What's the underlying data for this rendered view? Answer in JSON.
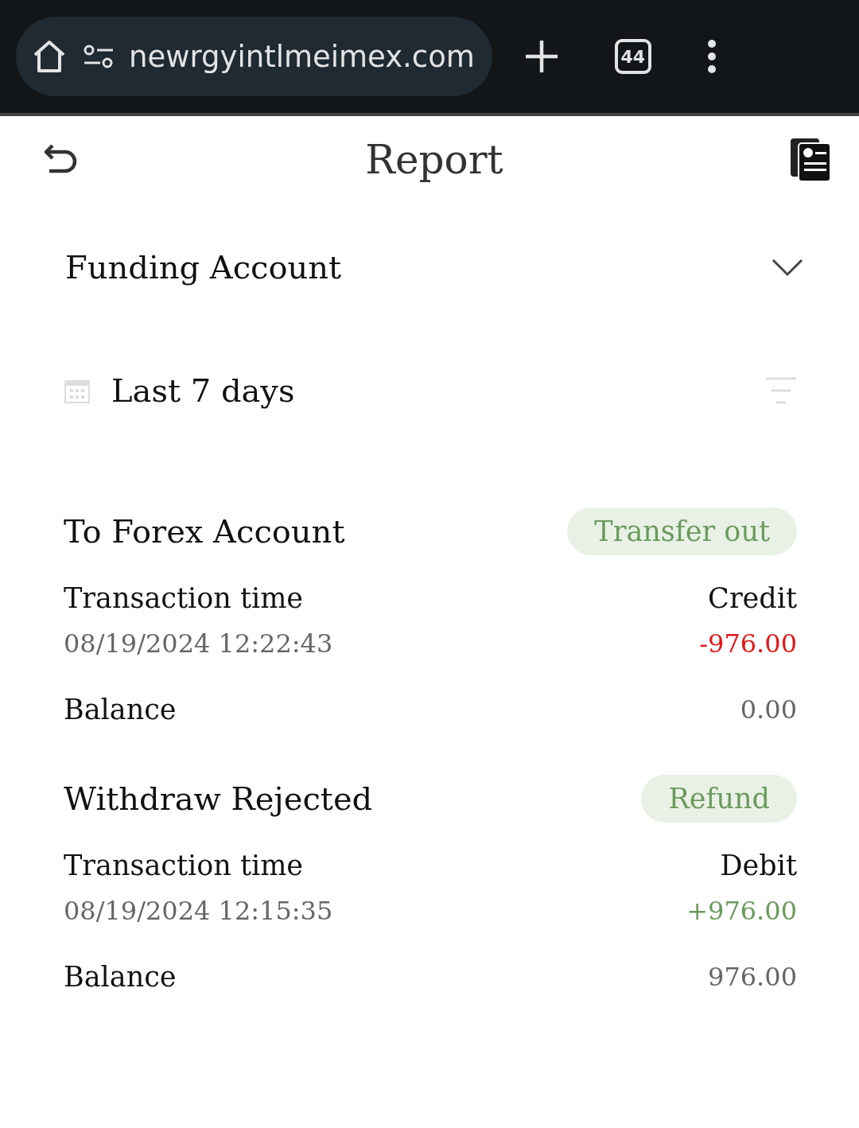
{
  "browser": {
    "url": "newrgyintlmeimex.com",
    "tab_count": "44"
  },
  "header": {
    "title": "Report"
  },
  "account": {
    "label": "Funding Account"
  },
  "period": {
    "label": "Last 7 days"
  },
  "transactions": [
    {
      "title": "To Forex Account",
      "tag": "Transfer out",
      "time_label": "Transaction time",
      "time": "08/19/2024 12:22:43",
      "type_label": "Credit",
      "amount": "-976.00",
      "color": "#e0191b",
      "balance_label": "Balance",
      "balance": "0.00"
    },
    {
      "title": "Withdraw Rejected",
      "tag": "Refund",
      "time_label": "Transaction time",
      "time": "08/19/2024 12:15:35",
      "type_label": "Debit",
      "amount": "+976.00",
      "color": "#6b9a5c",
      "balance_label": "Balance",
      "balance": "976.00"
    }
  ]
}
